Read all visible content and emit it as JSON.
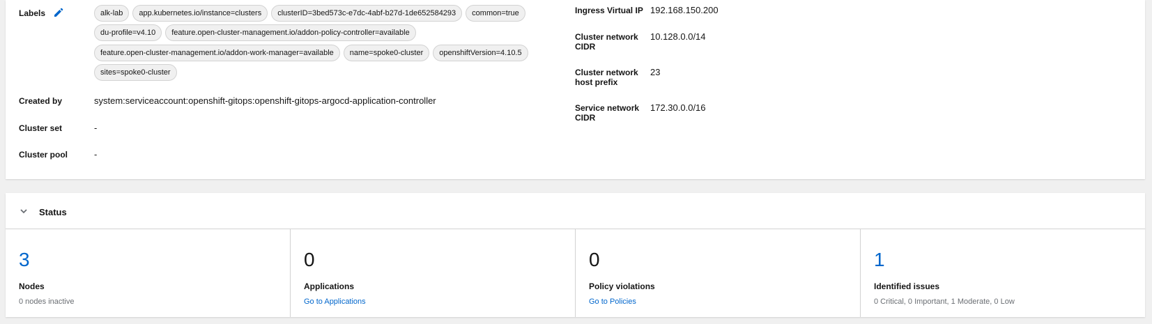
{
  "details": {
    "left": {
      "labels_term": "Labels",
      "labels": [
        [
          "alk-lab",
          "app.kubernetes.io/instance=clusters",
          "clusterID=3bed573c-e7dc-4abf-b27d-1de652584293",
          "common=true"
        ],
        [
          "du-profile=v4.10",
          "feature.open-cluster-management.io/addon-policy-controller=available"
        ],
        [
          "feature.open-cluster-management.io/addon-work-manager=available",
          "name=spoke0-cluster",
          "openshiftVersion=4.10.5"
        ],
        [
          "sites=spoke0-cluster"
        ]
      ],
      "created_by_term": "Created by",
      "created_by_value": "system:serviceaccount:openshift-gitops:openshift-gitops-argocd-application-controller",
      "cluster_set_term": "Cluster set",
      "cluster_set_value": "-",
      "cluster_pool_term": "Cluster pool",
      "cluster_pool_value": "-"
    },
    "right": {
      "ingress_vip_term": "Ingress Virtual IP",
      "ingress_vip_value": "192.168.150.200",
      "cluster_cidr_term_1": "Cluster network",
      "cluster_cidr_term_2": "CIDR",
      "cluster_cidr_value": "10.128.0.0/14",
      "host_prefix_term_1": "Cluster network",
      "host_prefix_term_2": "host prefix",
      "host_prefix_value": "23",
      "service_cidr_term_1": "Service network",
      "service_cidr_term_2": "CIDR",
      "service_cidr_value": "172.30.0.0/16"
    }
  },
  "status": {
    "title": "Status",
    "cards": [
      {
        "count": "3",
        "title": "Nodes",
        "sub": "0 nodes inactive"
      },
      {
        "count": "0",
        "title": "Applications",
        "sub": "Go to Applications"
      },
      {
        "count": "0",
        "title": "Policy violations",
        "sub": "Go to Policies"
      },
      {
        "count": "1",
        "title": "Identified issues",
        "sub": "0 Critical, 0 Important, 1 Moderate, 0 Low"
      }
    ]
  },
  "colors": {
    "link": "#0066cc",
    "border": "#d2d2d2",
    "page_bg": "#f0f0f0"
  }
}
